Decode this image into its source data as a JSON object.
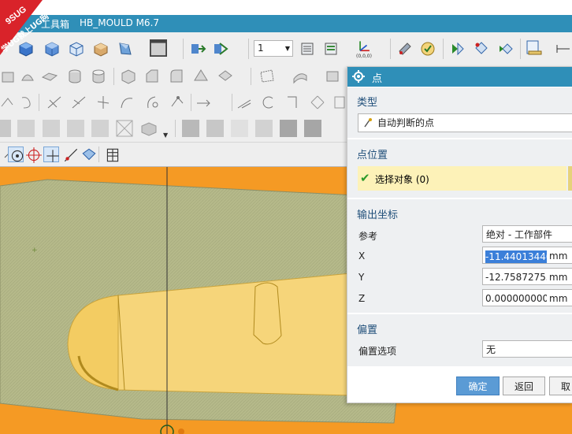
{
  "watermark": {
    "text": "学UG就上UG网",
    "brand": "9SUG"
  },
  "titlebar": {
    "prefix": "工具箱",
    "title": "HB_MOULD M6.7",
    "color": "#2f8fb8"
  },
  "toolbar": {
    "layer_value": "1",
    "coord_label": "(0,0,0)"
  },
  "dialog": {
    "title": "点",
    "type_section": {
      "header": "类型",
      "value": "自动判断的点"
    },
    "point_section": {
      "header": "点位置",
      "select_label": "选择对象 (0)"
    },
    "output_section": {
      "header": "输出坐标",
      "reference_label": "参考",
      "reference_value": "绝对 - 工作部件",
      "x_label": "X",
      "x_value": "-11.44013440",
      "x_unit": "mm",
      "y_label": "Y",
      "y_value": "-12.75872753",
      "y_unit": "mm",
      "z_label": "Z",
      "z_value": "0.0000000000",
      "z_unit": "mm"
    },
    "offset_section": {
      "header": "偏置",
      "option_label": "偏置选项",
      "option_value": "无"
    },
    "buttons": {
      "ok": "确定",
      "back": "返回",
      "cancel": "取消"
    }
  },
  "colors": {
    "viewport": "#f59a24",
    "part": "#f6d57a",
    "plane": "#b5b98a",
    "dialog_header": "#2f8fb8",
    "highlight": "#fdf2b8"
  }
}
